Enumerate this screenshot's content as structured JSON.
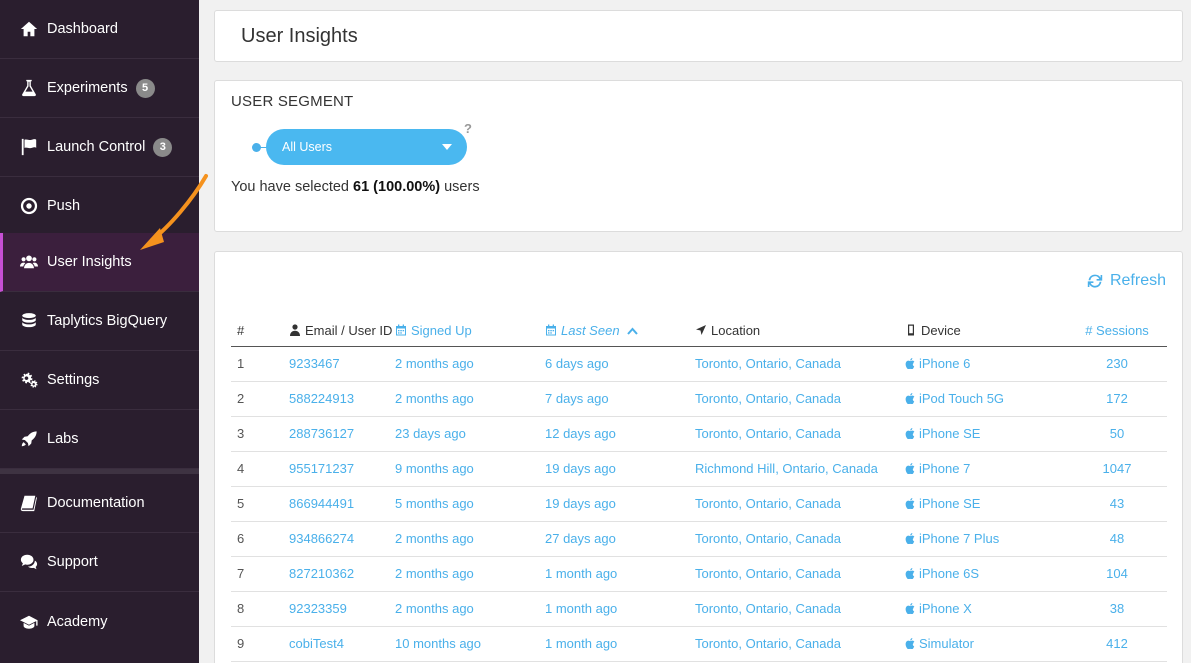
{
  "sidebar": {
    "items": [
      {
        "label": "Dashboard",
        "icon": "home-icon",
        "badge": null
      },
      {
        "label": "Experiments",
        "icon": "flask-icon",
        "badge": "5"
      },
      {
        "label": "Launch Control",
        "icon": "flag-icon",
        "badge": "3"
      },
      {
        "label": "Push",
        "icon": "target-icon",
        "badge": null
      },
      {
        "label": "User Insights",
        "icon": "users-icon",
        "badge": null
      },
      {
        "label": "Taplytics BigQuery",
        "icon": "database-icon",
        "badge": null
      },
      {
        "label": "Settings",
        "icon": "gears-icon",
        "badge": null
      },
      {
        "label": "Labs",
        "icon": "rocket-icon",
        "badge": null
      },
      {
        "label": "Documentation",
        "icon": "book-icon",
        "badge": null
      },
      {
        "label": "Support",
        "icon": "chat-icon",
        "badge": null
      },
      {
        "label": "Academy",
        "icon": "graduation-cap-icon",
        "badge": null
      }
    ],
    "active": "User Insights"
  },
  "header": {
    "title": "User Insights"
  },
  "segment": {
    "title": "USER SEGMENT",
    "selected": "All Users",
    "help": "?",
    "info_prefix": "You have selected ",
    "info_count": "61 (100.00%)",
    "info_suffix": " users"
  },
  "table": {
    "refresh_label": "Refresh",
    "columns": {
      "num": "#",
      "email": "Email / User ID",
      "signed_up": "Signed Up",
      "last_seen": "Last Seen",
      "location": "Location",
      "device": "Device",
      "sessions": "# Sessions"
    },
    "rows": [
      {
        "n": "1",
        "id": "9233467",
        "signed": "2 months ago",
        "seen": "6 days ago",
        "loc": "Toronto, Ontario, Canada",
        "device": "iPhone 6",
        "sessions": "230"
      },
      {
        "n": "2",
        "id": "588224913",
        "signed": "2 months ago",
        "seen": "7 days ago",
        "loc": "Toronto, Ontario, Canada",
        "device": "iPod Touch 5G",
        "sessions": "172"
      },
      {
        "n": "3",
        "id": "288736127",
        "signed": "23 days ago",
        "seen": "12 days ago",
        "loc": "Toronto, Ontario, Canada",
        "device": "iPhone SE",
        "sessions": "50"
      },
      {
        "n": "4",
        "id": "955171237",
        "signed": "9 months ago",
        "seen": "19 days ago",
        "loc": "Richmond Hill, Ontario, Canada",
        "device": "iPhone 7",
        "sessions": "1047"
      },
      {
        "n": "5",
        "id": "866944491",
        "signed": "5 months ago",
        "seen": "19 days ago",
        "loc": "Toronto, Ontario, Canada",
        "device": "iPhone SE",
        "sessions": "43"
      },
      {
        "n": "6",
        "id": "934866274",
        "signed": "2 months ago",
        "seen": "27 days ago",
        "loc": "Toronto, Ontario, Canada",
        "device": "iPhone 7 Plus",
        "sessions": "48"
      },
      {
        "n": "7",
        "id": "827210362",
        "signed": "2 months ago",
        "seen": "1 month ago",
        "loc": "Toronto, Ontario, Canada",
        "device": "iPhone 6S",
        "sessions": "104"
      },
      {
        "n": "8",
        "id": "92323359",
        "signed": "2 months ago",
        "seen": "1 month ago",
        "loc": "Toronto, Ontario, Canada",
        "device": "iPhone X",
        "sessions": "38"
      },
      {
        "n": "9",
        "id": "cobiTest4",
        "signed": "10 months ago",
        "seen": "1 month ago",
        "loc": "Toronto, Ontario, Canada",
        "device": "Simulator",
        "sessions": "412"
      }
    ]
  },
  "colors": {
    "sidebar_bg": "#2a1e2e",
    "active_accent": "#c64fd4",
    "link_blue": "#4ab0ea",
    "annotation_arrow": "#f5921e"
  }
}
